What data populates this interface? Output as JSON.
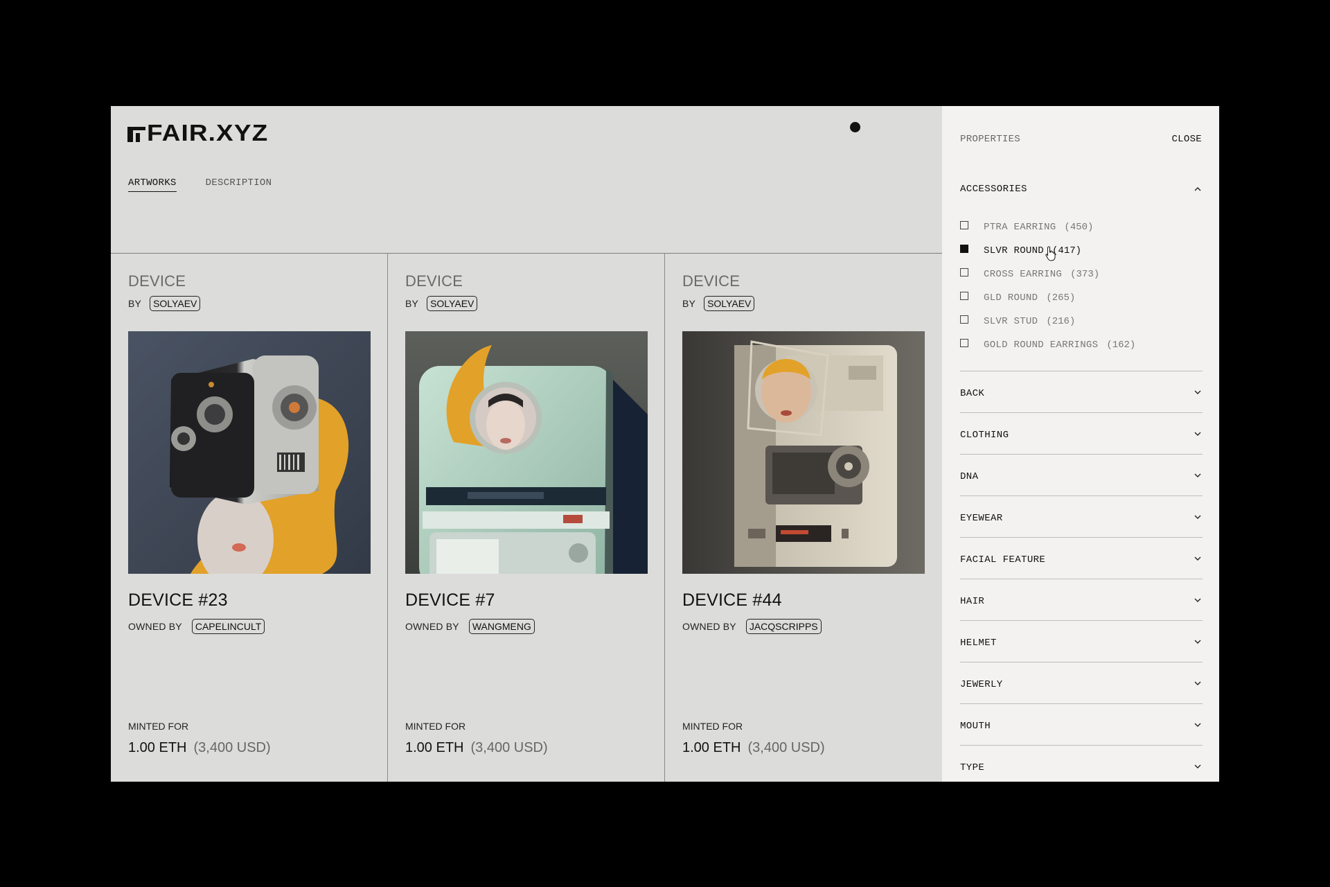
{
  "header": {
    "logo_text": "FAIR.XYZ",
    "tabs": [
      {
        "label": "ARTWORKS",
        "active": true
      },
      {
        "label": "DESCRIPTION",
        "active": false
      }
    ]
  },
  "cards": [
    {
      "kind": "DEVICE",
      "by_label": "BY",
      "creator": "SOLYAEV",
      "title": "DEVICE #23",
      "owned_label": "OWNED BY",
      "owner": "CAPELINCULT",
      "minted_label": "MINTED FOR",
      "price": "1.00 ETH",
      "price_usd": "(3,400 USD)"
    },
    {
      "kind": "DEVICE",
      "by_label": "BY",
      "creator": "SOLYAEV",
      "title": "DEVICE #7",
      "owned_label": "OWNED BY",
      "owner": "WANGMENG",
      "minted_label": "MINTED FOR",
      "price": "1.00 ETH",
      "price_usd": "(3,400 USD)"
    },
    {
      "kind": "DEVICE",
      "by_label": "BY",
      "creator": "SOLYAEV",
      "title": "DEVICE #44",
      "owned_label": "OWNED BY",
      "owner": "JACQSCRIPPS",
      "minted_label": "MINTED FOR",
      "price": "1.00 ETH",
      "price_usd": "(3,400 USD)"
    }
  ],
  "properties": {
    "title": "PROPERTIES",
    "close_label": "CLOSE",
    "expanded": {
      "name": "ACCESSORIES",
      "options": [
        {
          "label": "PTRA EARRING",
          "count": "(450)",
          "checked": false
        },
        {
          "label": "SLVR ROUND",
          "count": "(417)",
          "checked": true
        },
        {
          "label": "CROSS EARRING",
          "count": "(373)",
          "checked": false
        },
        {
          "label": "GLD ROUND",
          "count": "(265)",
          "checked": false
        },
        {
          "label": "SLVR STUD",
          "count": "(216)",
          "checked": false
        },
        {
          "label": "GOLD ROUND EARRINGS",
          "count": "(162)",
          "checked": false
        }
      ]
    },
    "sections": [
      "BACK",
      "CLOTHING",
      "DNA",
      "EYEWEAR",
      "FACIAL FEATURE",
      "HAIR",
      "HELMET",
      "JEWERLY",
      "MOUTH",
      "TYPE"
    ]
  },
  "colors": {
    "background": "#000000",
    "main_bg": "#dcdcda",
    "panel_bg": "#f3f2f0",
    "accent_yellow": "#e2a128"
  }
}
